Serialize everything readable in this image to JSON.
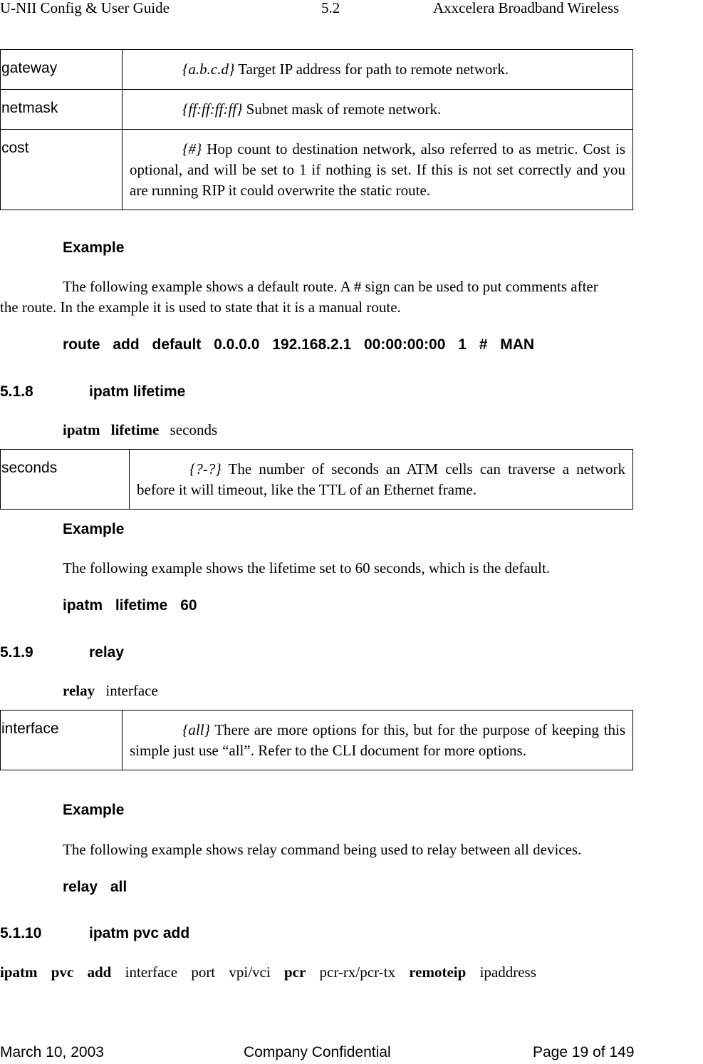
{
  "header": {
    "left": "U-NII Config & User Guide",
    "center": "5.2",
    "right": "Axxcelera Broadband Wireless"
  },
  "route_params": [
    {
      "name": "gateway",
      "format": "{a.b.c.d}",
      "description": " Target IP address for path to remote network."
    },
    {
      "name": "netmask",
      "format": "{ff:ff:ff:ff}",
      "description": " Subnet mask of remote network."
    },
    {
      "name": "cost",
      "format": "{#}",
      "description": " Hop count to destination network, also referred to as metric. Cost is optional, and will be set to 1 if nothing is set. If this is not set correctly and you are running RIP it could overwrite the static route."
    }
  ],
  "route_example": {
    "heading": "Example",
    "text_line1": "The following example shows a default route. A # sign can be used to put comments after",
    "text_line2": "the route. In the example it is used to state that it is a manual route.",
    "command": "route add default 0.0.0.0 192.168.2.1 00:00:00:00 1 # MAN"
  },
  "section_518": {
    "number": "5.1.8",
    "title": "ipatm lifetime",
    "syntax_bold": [
      "ipatm",
      "lifetime"
    ],
    "syntax_args": [
      "seconds"
    ],
    "params": [
      {
        "name": "seconds",
        "format": "{?-?}",
        "description": " The number of seconds an ATM cells can traverse a network before it will timeout, like the TTL of an Ethernet frame."
      }
    ],
    "example_heading": "Example",
    "example_text": "The following example shows the lifetime set to 60 seconds, which is the default.",
    "example_command": "ipatm lifetime 60"
  },
  "section_519": {
    "number": "5.1.9",
    "title": "relay",
    "syntax_bold": [
      "relay"
    ],
    "syntax_args": [
      "interface"
    ],
    "params": [
      {
        "name": "interface",
        "format": "{all}",
        "description": " There are more options for this, but for the purpose of keeping this simple just use “all”. Refer to the CLI document for more options."
      }
    ],
    "example_heading": "Example",
    "example_text": "The following example shows relay command being used to relay between all devices.",
    "example_command": "relay all"
  },
  "section_5110": {
    "number": "5.1.10",
    "title": "ipatm pvc add",
    "syntax": [
      {
        "text": "ipatm",
        "bold": true
      },
      {
        "text": "pvc",
        "bold": true
      },
      {
        "text": "add",
        "bold": true
      },
      {
        "text": "interface",
        "bold": false
      },
      {
        "text": "port",
        "bold": false
      },
      {
        "text": "vpi/vci",
        "bold": false
      },
      {
        "text": "pcr",
        "bold": true
      },
      {
        "text": "pcr-rx/pcr-tx",
        "bold": false
      },
      {
        "text": "remoteip",
        "bold": true
      },
      {
        "text": "ipaddress",
        "bold": false
      }
    ]
  },
  "footer": {
    "date": "March 10, 2003",
    "confidential": "Company Confidential",
    "page": "Page 19 of 149"
  }
}
